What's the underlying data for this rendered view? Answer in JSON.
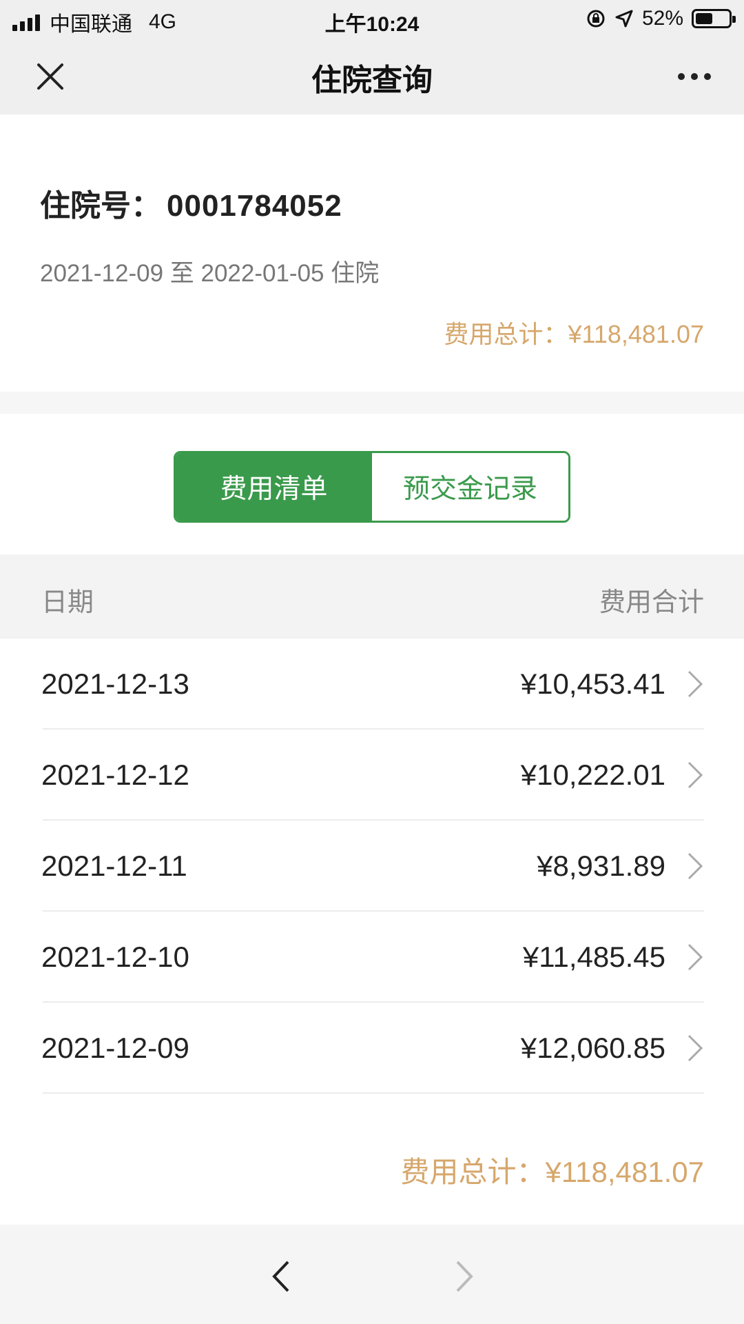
{
  "status_bar": {
    "carrier": "中国联通",
    "network": "4G",
    "time": "上午10:24",
    "battery": "52%",
    "battery_level": 0.52
  },
  "nav": {
    "title": "住院查询"
  },
  "info": {
    "admission_label": "住院号：",
    "admission_no": "0001784052",
    "period": "2021-12-09 至 2022-01-05 住院",
    "total_label": "费用总计：",
    "total_value": "¥118,481.07"
  },
  "tabs": [
    {
      "label": "费用清单",
      "active": true
    },
    {
      "label": "预交金记录",
      "active": false
    }
  ],
  "table": {
    "col_date": "日期",
    "col_total": "费用合计",
    "rows": [
      {
        "date": "2021-12-13",
        "amount": "¥10,453.41"
      },
      {
        "date": "2021-12-12",
        "amount": "¥10,222.01"
      },
      {
        "date": "2021-12-11",
        "amount": "¥8,931.89"
      },
      {
        "date": "2021-12-10",
        "amount": "¥11,485.45"
      },
      {
        "date": "2021-12-09",
        "amount": "¥12,060.85"
      }
    ],
    "total_label": "费用总计：",
    "total_value": "¥118,481.07"
  },
  "colors": {
    "accent_green": "#3a9a4b",
    "total_orange": "#d6a76b"
  },
  "icons": {
    "close": "close-icon",
    "more": "more-dots-icon",
    "row_chevron": "chevron-right-icon",
    "back": "chevron-left-icon",
    "forward": "chevron-right-icon"
  }
}
